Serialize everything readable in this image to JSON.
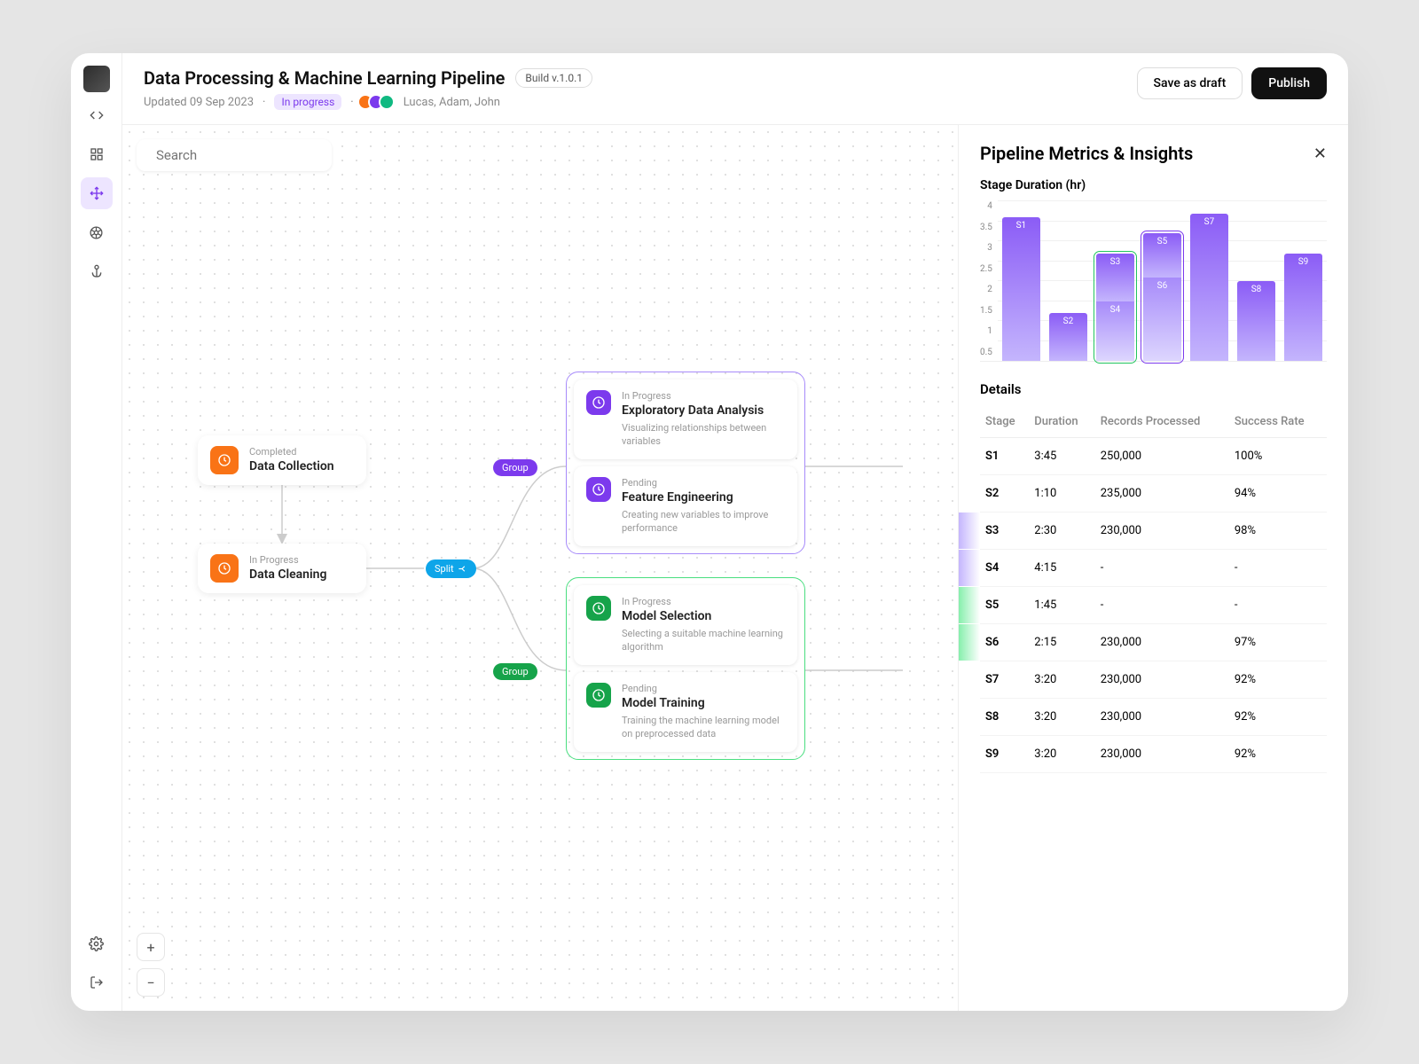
{
  "header": {
    "title": "Data Processing & Machine Learning Pipeline",
    "version": "Build v.1.0.1",
    "updated": "Updated 09 Sep 2023",
    "status": "In progress",
    "collaborators": "Lucas, Adam, John",
    "save_draft": "Save as draft",
    "publish": "Publish"
  },
  "search": {
    "placeholder": "Search"
  },
  "canvas": {
    "split_label": "Split",
    "group_label": "Group",
    "nodes": {
      "n1": {
        "status": "Completed",
        "title": "Data Collection"
      },
      "n2": {
        "status": "In Progress",
        "title": "Data Cleaning"
      },
      "g1a": {
        "status": "In Progress",
        "title": "Exploratory Data Analysis",
        "desc": "Visualizing relationships between variables"
      },
      "g1b": {
        "status": "Pending",
        "title": "Feature Engineering",
        "desc": "Creating new variables to improve performance"
      },
      "g2a": {
        "status": "In Progress",
        "title": "Model Selection",
        "desc": "Selecting a suitable machine learning algorithm"
      },
      "g2b": {
        "status": "Pending",
        "title": "Model Training",
        "desc": "Training the machine learning model on preprocessed data"
      }
    }
  },
  "panel": {
    "title": "Pipeline Metrics & Insights",
    "chart_title": "Stage Duration (hr)",
    "details_title": "Details",
    "columns": {
      "c1": "Stage",
      "c2": "Duration",
      "c3": "Records Processed",
      "c4": "Success Rate"
    },
    "rows": [
      {
        "stage": "S1",
        "duration": "3:45",
        "records": "250,000",
        "rate": "100%"
      },
      {
        "stage": "S2",
        "duration": "1:10",
        "records": "235,000",
        "rate": "94%"
      },
      {
        "stage": "S3",
        "duration": "2:30",
        "records": "230,000",
        "rate": "98%"
      },
      {
        "stage": "S4",
        "duration": "4:15",
        "records": "-",
        "rate": "-"
      },
      {
        "stage": "S5",
        "duration": "1:45",
        "records": "-",
        "rate": "-"
      },
      {
        "stage": "S6",
        "duration": "2:15",
        "records": "230,000",
        "rate": "97%"
      },
      {
        "stage": "S7",
        "duration": "3:20",
        "records": "230,000",
        "rate": "92%"
      },
      {
        "stage": "S8",
        "duration": "3:20",
        "records": "230,000",
        "rate": "92%"
      },
      {
        "stage": "S9",
        "duration": "3:20",
        "records": "230,000",
        "rate": "92%"
      }
    ]
  },
  "chart_data": {
    "type": "bar",
    "title": "Stage Duration (hr)",
    "ylabel": "hours",
    "ylim": [
      0,
      4
    ],
    "yticks": [
      0.5,
      1,
      1.5,
      2,
      2.5,
      3,
      3.5,
      4
    ],
    "columns": [
      {
        "label": "S1",
        "bars": [
          {
            "label": "S1",
            "value": 3.6
          }
        ]
      },
      {
        "label": "S2",
        "bars": [
          {
            "label": "S2",
            "value": 1.2
          }
        ]
      },
      {
        "label": "S3S4",
        "stacked": true,
        "highlight": "green",
        "bars": [
          {
            "label": "S3",
            "value": 1.2
          },
          {
            "label": "S4",
            "value": 1.5
          }
        ]
      },
      {
        "label": "S5S6",
        "stacked": true,
        "highlight": "purple",
        "bars": [
          {
            "label": "S5",
            "value": 1.1
          },
          {
            "label": "S6",
            "value": 2.1
          }
        ]
      },
      {
        "label": "S7",
        "bars": [
          {
            "label": "S7",
            "value": 3.7
          }
        ]
      },
      {
        "label": "S8",
        "bars": [
          {
            "label": "S8",
            "value": 2.0
          }
        ]
      },
      {
        "label": "S9",
        "bars": [
          {
            "label": "S9",
            "value": 2.7
          }
        ]
      }
    ]
  }
}
